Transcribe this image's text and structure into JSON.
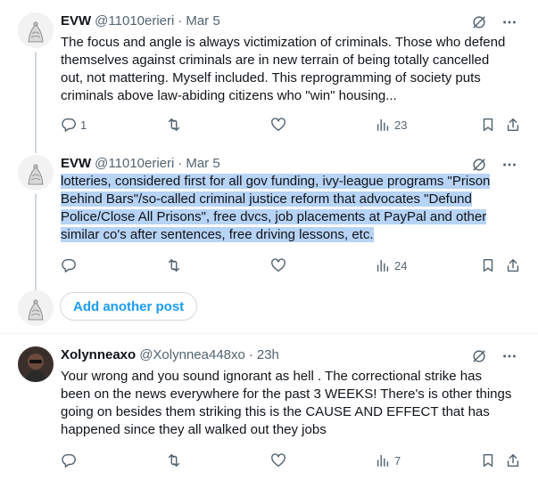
{
  "posts": [
    {
      "name": "EVW",
      "handle": "@11010erieri",
      "date": "Mar 5",
      "text": "The focus and angle is always victimization of criminals. Those who defend themselves against criminals are in new terrain of being totally cancelled out, not mattering. Myself included. This reprogramming of society puts criminals above law-abiding citizens who \"win\" housing...",
      "replies": "1",
      "reposts": "",
      "likes": "",
      "views": "23"
    },
    {
      "name": "EVW",
      "handle": "@11010erieri",
      "date": "Mar 5",
      "text": "lotteries, considered first for all gov funding, ivy-league programs \"Prison Behind Bars\"/so-called criminal justice reform that advocates \"Defund Police/Close All Prisons\", free dvcs, job placements at PayPal and other similar co's after sentences, free driving lessons, etc.",
      "replies": "",
      "reposts": "",
      "likes": "",
      "views": "24"
    },
    {
      "name": "Xolynneaxo",
      "handle": "@Xolynnea448xo",
      "date": "23h",
      "text": "Your wrong and you sound ignorant as hell . The correctional strike has been on the news everywhere for the past 3 WEEKS! There's is other things going on besides them striking this is the CAUSE AND EFFECT that has happened since they all walked out they jobs",
      "replies": "",
      "reposts": "",
      "likes": "",
      "views": "7"
    }
  ],
  "compose": {
    "add_another_label": "Add another post"
  },
  "icons": {
    "grok": "grok-icon",
    "more": "more-icon",
    "reply": "reply-icon",
    "repost": "repost-icon",
    "like": "like-icon",
    "views": "views-icon",
    "bookmark": "bookmark-icon",
    "share": "share-icon"
  },
  "colors": {
    "accent": "#1d9bf0",
    "secondary_text": "#536471",
    "selection": "#b7d3f5",
    "divider": "#eff3f4"
  }
}
